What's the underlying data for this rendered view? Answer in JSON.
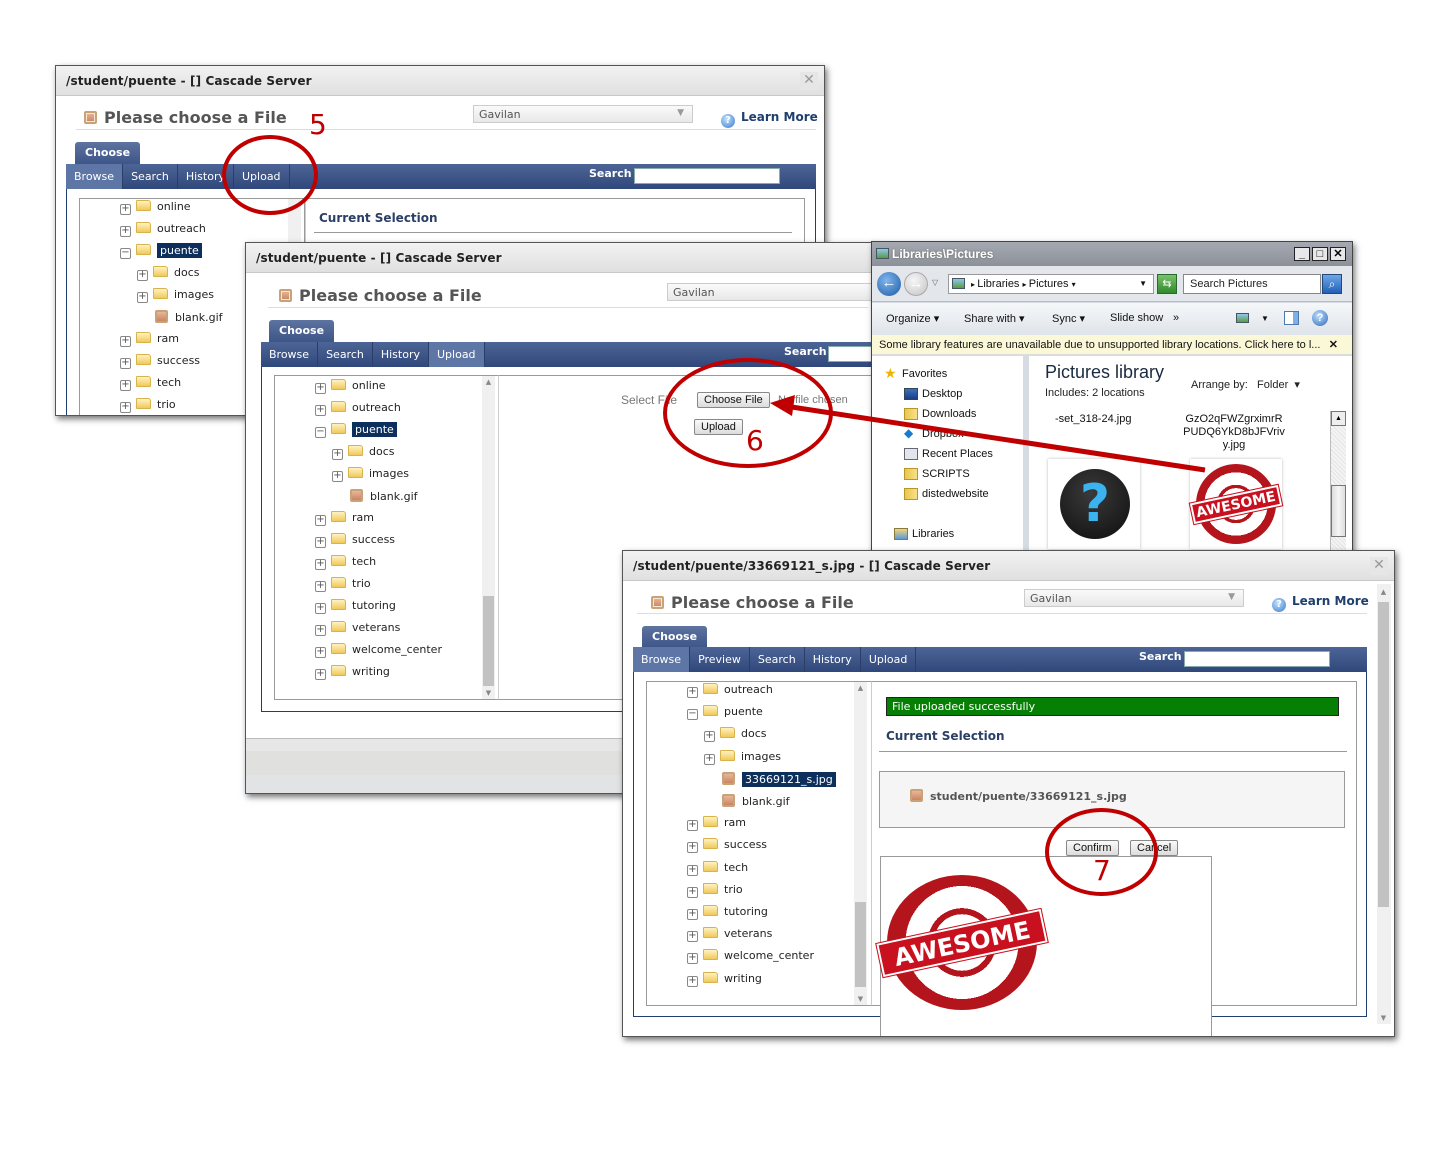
{
  "window1": {
    "title": "/student/puente - [] Cascade Server",
    "close_glyph": "✕",
    "heading": "Please choose a File",
    "site_select": "Gavilan",
    "learn_more": "Learn More",
    "choose_tab": "Choose",
    "nav_tabs": [
      "Browse",
      "Search",
      "History",
      "Upload"
    ],
    "active_tab": "Browse",
    "search_label": "Search",
    "search_value": "",
    "current_selection": "Current Selection",
    "tree": [
      {
        "label": "online",
        "toggle": "+",
        "type": "folder",
        "depth": 0
      },
      {
        "label": "outreach",
        "toggle": "+",
        "type": "folder",
        "depth": 0
      },
      {
        "label": "puente",
        "toggle": "−",
        "type": "folder",
        "depth": 0,
        "selected": true
      },
      {
        "label": "docs",
        "toggle": "+",
        "type": "folder",
        "depth": 1
      },
      {
        "label": "images",
        "toggle": "+",
        "type": "folder",
        "depth": 1
      },
      {
        "label": "blank.gif",
        "type": "file",
        "depth": 1
      },
      {
        "label": "ram",
        "toggle": "+",
        "type": "folder",
        "depth": 0
      },
      {
        "label": "success",
        "toggle": "+",
        "type": "folder",
        "depth": 0
      },
      {
        "label": "tech",
        "toggle": "+",
        "type": "folder",
        "depth": 0
      },
      {
        "label": "trio",
        "toggle": "+",
        "type": "folder",
        "depth": 0
      }
    ]
  },
  "window2": {
    "title": "/student/puente - [] Cascade Server",
    "heading": "Please choose a File",
    "site_select": "Gavilan",
    "choose_tab": "Choose",
    "nav_tabs": [
      "Browse",
      "Search",
      "History",
      "Upload"
    ],
    "active_tab": "Upload",
    "search_label": "Search",
    "select_file_label": "Select File",
    "choose_file_button": "Choose File",
    "no_file_text": "No file chosen",
    "upload_button": "Upload",
    "tree": [
      {
        "label": "online",
        "toggle": "+",
        "type": "folder",
        "depth": 0
      },
      {
        "label": "outreach",
        "toggle": "+",
        "type": "folder",
        "depth": 0
      },
      {
        "label": "puente",
        "toggle": "−",
        "type": "folder",
        "depth": 0,
        "selected": true
      },
      {
        "label": "docs",
        "toggle": "+",
        "type": "folder",
        "depth": 1
      },
      {
        "label": "images",
        "toggle": "+",
        "type": "folder",
        "depth": 1
      },
      {
        "label": "blank.gif",
        "type": "file",
        "depth": 1
      },
      {
        "label": "ram",
        "toggle": "+",
        "type": "folder",
        "depth": 0
      },
      {
        "label": "success",
        "toggle": "+",
        "type": "folder",
        "depth": 0
      },
      {
        "label": "tech",
        "toggle": "+",
        "type": "folder",
        "depth": 0
      },
      {
        "label": "trio",
        "toggle": "+",
        "type": "folder",
        "depth": 0
      },
      {
        "label": "tutoring",
        "toggle": "+",
        "type": "folder",
        "depth": 0
      },
      {
        "label": "veterans",
        "toggle": "+",
        "type": "folder",
        "depth": 0
      },
      {
        "label": "welcome_center",
        "toggle": "+",
        "type": "folder",
        "depth": 0
      },
      {
        "label": "writing",
        "toggle": "+",
        "type": "folder",
        "depth": 0
      }
    ]
  },
  "explorer": {
    "title": "Libraries\\Pictures",
    "window_buttons": [
      "_",
      "□",
      "✕"
    ],
    "breadcrumb": [
      "Libraries",
      "Pictures"
    ],
    "search_placeholder": "Search Pictures",
    "commands": [
      "Organize",
      "Share with",
      "Sync",
      "Slide show",
      "»"
    ],
    "info_bar": "Some library features are unavailable due to unsupported library locations. Click here to l...",
    "info_close": "✕",
    "nav_items": [
      {
        "label": "Favorites",
        "icon": "star-icon"
      },
      {
        "label": "Desktop",
        "icon": "desktop-icon"
      },
      {
        "label": "Downloads",
        "icon": "downloads-folder-icon"
      },
      {
        "label": "Dropbox",
        "icon": "dropbox-icon"
      },
      {
        "label": "Recent Places",
        "icon": "recent-places-icon"
      },
      {
        "label": "SCRIPTS",
        "icon": "folder-icon"
      },
      {
        "label": "distedwebsite",
        "icon": "folder-icon"
      },
      {
        "label": "Libraries",
        "icon": "libraries-icon"
      }
    ],
    "library_title": "Pictures library",
    "library_includes": "Includes:  2 locations",
    "arrange_by_label": "Arrange by:",
    "arrange_by_value": "Folder",
    "files": [
      {
        "name": "-set_318-24.jpg",
        "thumb": "question-mark-image"
      },
      {
        "name": "GzO2qFWZgrximrRPUDQ6YkD8bJFVrivy.jpg",
        "name_lines": [
          "GzO2qFWZgrximrR",
          "PUDQ6YkD8bJFVriv",
          "y.jpg"
        ],
        "thumb": "awesome-stamp-image"
      }
    ]
  },
  "window3": {
    "title": "/student/puente/33669121_s.jpg - [] Cascade Server",
    "heading": "Please choose a File",
    "site_select": "Gavilan",
    "learn_more": "Learn More",
    "choose_tab": "Choose",
    "nav_tabs": [
      "Browse",
      "Preview",
      "Search",
      "History",
      "Upload"
    ],
    "active_tab": "Browse",
    "search_label": "Search",
    "success_message": "File uploaded successfully",
    "current_selection": "Current Selection",
    "selected_path": "student/puente/33669121_s.jpg",
    "confirm_button": "Confirm",
    "cancel_button": "Cancel",
    "preview_image": "AWESOME",
    "tree": [
      {
        "label": "outreach",
        "toggle": "+",
        "type": "folder",
        "depth": 0
      },
      {
        "label": "puente",
        "toggle": "−",
        "type": "folder",
        "depth": 0
      },
      {
        "label": "docs",
        "toggle": "+",
        "type": "folder",
        "depth": 1
      },
      {
        "label": "images",
        "toggle": "+",
        "type": "folder",
        "depth": 1
      },
      {
        "label": "33669121_s.jpg",
        "type": "file",
        "depth": 1,
        "selected": true
      },
      {
        "label": "blank.gif",
        "type": "file",
        "depth": 1
      },
      {
        "label": "ram",
        "toggle": "+",
        "type": "folder",
        "depth": 0
      },
      {
        "label": "success",
        "toggle": "+",
        "type": "folder",
        "depth": 0
      },
      {
        "label": "tech",
        "toggle": "+",
        "type": "folder",
        "depth": 0
      },
      {
        "label": "trio",
        "toggle": "+",
        "type": "folder",
        "depth": 0
      },
      {
        "label": "tutoring",
        "toggle": "+",
        "type": "folder",
        "depth": 0
      },
      {
        "label": "veterans",
        "toggle": "+",
        "type": "folder",
        "depth": 0
      },
      {
        "label": "welcome_center",
        "toggle": "+",
        "type": "folder",
        "depth": 0
      },
      {
        "label": "writing",
        "toggle": "+",
        "type": "folder",
        "depth": 0
      }
    ]
  },
  "annotations": {
    "step5": "5",
    "step6": "6",
    "step7": "7",
    "color": "#c00000"
  },
  "colors": {
    "navbar": "#3a5285",
    "selection": "#0c2f5c",
    "success_bar": "#058005",
    "heading_text": "#555555"
  }
}
